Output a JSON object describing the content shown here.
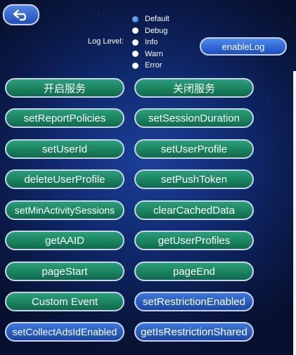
{
  "log_level": {
    "label": "Log Level:",
    "options": [
      "Default",
      "Debug",
      "Info",
      "Warn",
      "Error"
    ],
    "selected": "Default"
  },
  "enable_log_label": "enableLog",
  "buttons": {
    "start_service": "开启服务",
    "stop_service": "关闭服务",
    "set_report_policies": "setReportPolicies",
    "set_session_duration": "setSessionDuration",
    "set_user_id": "setUserId",
    "set_user_profile": "setUserProfile",
    "delete_user_profile": "deleteUserProfile",
    "set_push_token": "setPushToken",
    "set_min_activity_sessions": "setMinActivitySessions",
    "clear_cached_data": "clearCachedData",
    "get_aaid": "getAAID",
    "get_user_profiles": "getUserProfiles",
    "page_start": "pageStart",
    "page_end": "pageEnd",
    "custom_event": "Custom Event",
    "set_restriction_enabled": "setRestrictionEnabled",
    "set_collect_ads_id_enabled": "setCollectAdsIdEnabled",
    "get_is_restriction_shared": "getIsRestrictionShared"
  },
  "colors": {
    "green_button": "#1c8762",
    "blue_button": "#2a5fc6",
    "background": "#102a6f"
  }
}
